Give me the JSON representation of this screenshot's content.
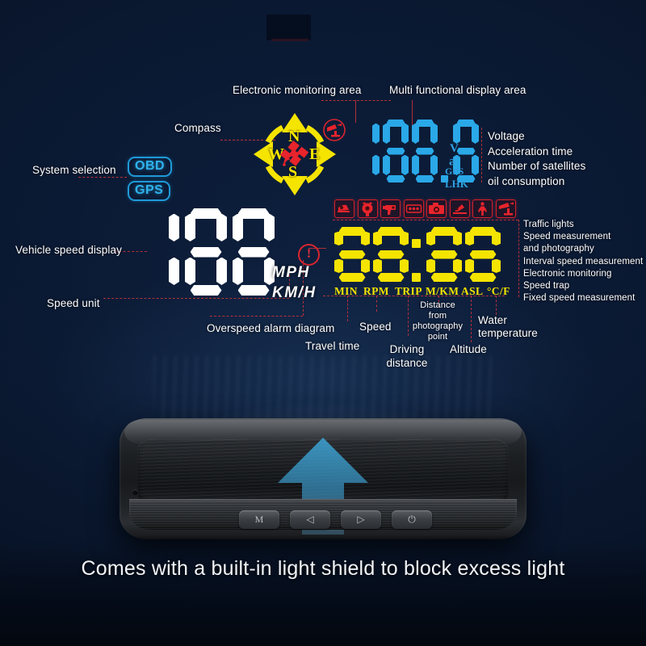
{
  "background": {
    "base_color": "#0a1730",
    "accent_blue": "#2aa8e8",
    "accent_yellow": "#f5e400",
    "accent_red": "#d4202a"
  },
  "callouts": {
    "electronic_monitoring_area": "Electronic monitoring area",
    "multi_functional_display_area": "Multi functional display area",
    "compass": "Compass",
    "system_selection": "System selection",
    "vehicle_speed_display": "Vehicle speed display",
    "speed_unit": "Speed unit",
    "overspeed_alarm_diagram": "Overspeed alarm diagram",
    "travel_time": "Travel time",
    "speed": "Speed",
    "driving_distance": "Driving\ndistance",
    "driving_distance_l1": "Driving",
    "driving_distance_l2": "distance",
    "distance_from_photography_point": "Distance\nfrom\nphotography\npoint",
    "dist_photo_l1": "Distance",
    "dist_photo_l2": "from",
    "dist_photo_l3": "photography",
    "dist_photo_l4": "point",
    "altitude": "Altitude",
    "water_temperature_l1": "Water",
    "water_temperature_l2": "temperature"
  },
  "system_selection": {
    "options": [
      "OBD",
      "GPS"
    ],
    "obd": "OBD",
    "gps": "GPS"
  },
  "compass": {
    "north": "N",
    "south": "S",
    "east": "E",
    "west": "W",
    "center_icon": "satellite-icon"
  },
  "multi_display": {
    "value": "188.8",
    "digits": [
      "1",
      "8",
      "8",
      "8"
    ],
    "decimal_after_index": 2,
    "units": [
      "V",
      "a⁺",
      "GPS",
      "LHK"
    ],
    "unit_v": "V",
    "unit_a": "a",
    "unit_a_sup": "+",
    "unit_gps": "GPS",
    "unit_lhk": "LHK",
    "meanings": [
      "Voltage",
      "Acceleration time",
      "Number of satellites",
      "oil consumption"
    ],
    "meaning_1": "Voltage",
    "meaning_2": "Acceleration time",
    "meaning_3": "Number of satellites",
    "meaning_4": "oil consumption"
  },
  "speed_display": {
    "value": "188",
    "digits": [
      "1",
      "8",
      "8"
    ],
    "unit_mph": "MPH",
    "unit_kmh": "KM/H",
    "alarm_icon": "warning-exclamation-icon",
    "alarm_glyph": "!"
  },
  "monitoring_icons": {
    "items": [
      {
        "name": "traffic-light-camera-icon"
      },
      {
        "name": "speed-camera-photography-icon"
      },
      {
        "name": "handheld-speed-gun-icon"
      },
      {
        "name": "interval-speed-measurement-icon"
      },
      {
        "name": "electronic-monitoring-camera-icon"
      },
      {
        "name": "speed-trap-icon"
      },
      {
        "name": "pedestrian-crossing-icon"
      },
      {
        "name": "fixed-speed-measurement-icon"
      }
    ],
    "legend": [
      "Traffic lights",
      "Speed measurement",
      "and photography",
      "Interval speed measurement",
      "Electronic monitoring",
      "Speed trap",
      "Fixed speed measurement"
    ],
    "legend_1": "Traffic lights",
    "legend_2": "Speed measurement",
    "legend_3": "and photography",
    "legend_4": "Interval speed measurement",
    "legend_5": "Electronic monitoring",
    "legend_6": "Speed trap",
    "legend_7": "Fixed speed measurement"
  },
  "multi_value_display": {
    "value": "88:88",
    "digits": [
      "8",
      "8",
      "8",
      "8"
    ],
    "colon_after_index": 1,
    "units": [
      "MIN",
      "RPM",
      "TRIP",
      "M/KM",
      "ASL",
      "°C/F"
    ],
    "unit_min": "MIN",
    "unit_rpm": "RPM",
    "unit_trip": "TRIP",
    "unit_mkm": "M/KM",
    "unit_asl": "ASL",
    "unit_cf": "°C/F"
  },
  "device": {
    "buttons": [
      {
        "label": "M",
        "icon": "menu-m-button"
      },
      {
        "label": "◁",
        "icon": "left-arrow-button"
      },
      {
        "label": "▷",
        "icon": "right-arrow-button"
      },
      {
        "label": "⏻",
        "icon": "power-button"
      }
    ],
    "button_m": "M",
    "button_left": "◁",
    "button_right": "▷",
    "button_power": "⏻",
    "arrow_icon": "up-arrow-icon"
  },
  "caption": "Comes with a built-in light shield to block excess light"
}
